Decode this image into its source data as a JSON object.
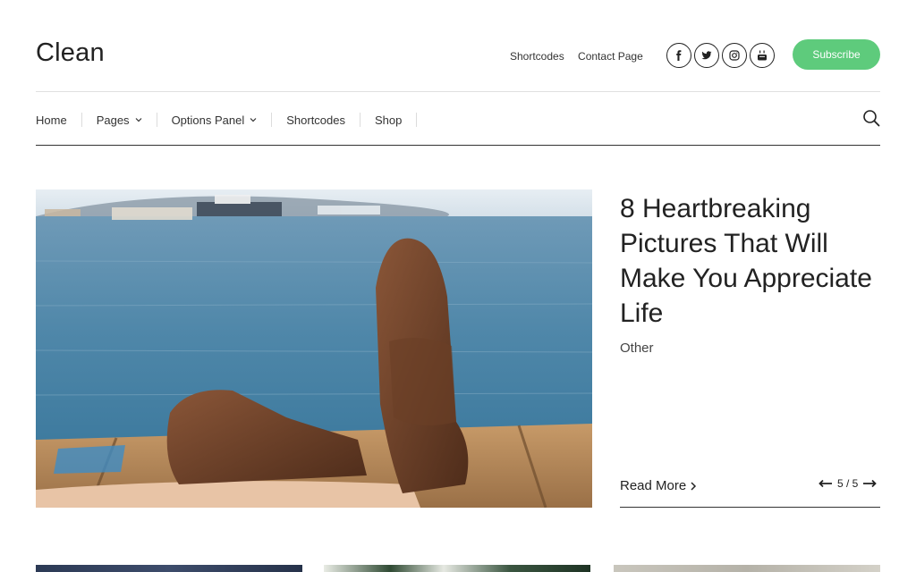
{
  "header": {
    "logo": "Clean",
    "links": [
      "Shortcodes",
      "Contact Page"
    ],
    "socials": [
      "facebook-icon",
      "twitter-icon",
      "instagram-icon",
      "youtube-icon"
    ],
    "subscribe_label": "Subscribe",
    "accent": "#5ecb7c"
  },
  "nav": {
    "items": [
      {
        "label": "Home",
        "dropdown": false
      },
      {
        "label": "Pages",
        "dropdown": true
      },
      {
        "label": "Options Panel",
        "dropdown": true
      },
      {
        "label": "Shortcodes",
        "dropdown": false
      },
      {
        "label": "Shop",
        "dropdown": false
      }
    ],
    "search_icon": "search-icon"
  },
  "featured": {
    "title": "8 Heartbreaking Pictures That Will Make You Appreciate Life",
    "category": "Other",
    "read_more": "Read More",
    "pager": "5 / 5"
  }
}
